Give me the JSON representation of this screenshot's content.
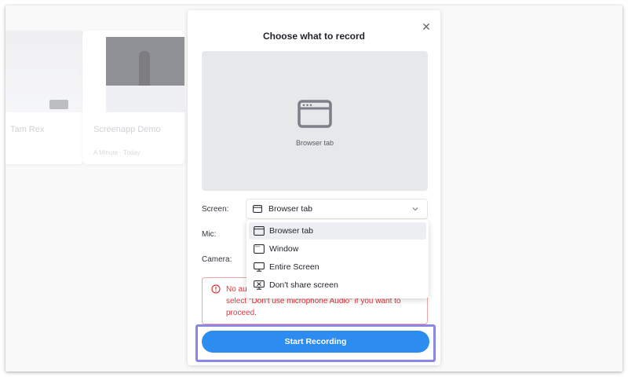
{
  "background": {
    "cards": [
      {
        "title": "Tam Rex",
        "meta": ""
      },
      {
        "title": "Screenapp Demo",
        "meta": "A Minute · Today"
      }
    ]
  },
  "modal": {
    "title": "Choose what to record",
    "close_glyph": "✕",
    "preview": {
      "label": "Browser tab",
      "icon": "browser-tab-icon"
    },
    "screen_label": "Screen:",
    "mic_label": "Mic:",
    "camera_label": "Camera:",
    "screen_select": {
      "value": "Browser tab"
    },
    "alert": {
      "text_line1": "No au",
      "text_line2": "select \"Don't use microphone Audio\" if you want to",
      "text_line3": "proceed."
    },
    "start_button": "Start Recording"
  },
  "dropdown": {
    "options": [
      {
        "label": "Browser tab",
        "icon": "browser-tab-icon",
        "selected": true
      },
      {
        "label": "Window",
        "icon": "window-icon",
        "selected": false
      },
      {
        "label": "Entire Screen",
        "icon": "monitor-icon",
        "selected": false
      },
      {
        "label": "Don't share screen",
        "icon": "no-share-icon",
        "selected": false
      }
    ]
  },
  "colors": {
    "primary": "#2d8cf0",
    "alert": "#e0353a",
    "highlight": "#8a86e6"
  }
}
